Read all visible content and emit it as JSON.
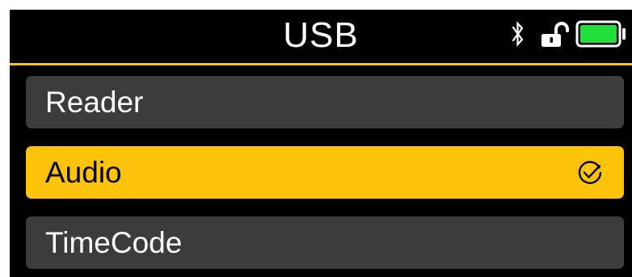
{
  "header": {
    "title": "USB"
  },
  "status": {
    "bluetooth_icon": "bluetooth-icon",
    "lock_icon": "unlocked-padlock-icon",
    "battery_icon": "battery-full-icon",
    "battery_fill_color": "#21E03C"
  },
  "menu": {
    "items": [
      {
        "label": "Reader",
        "selected": false
      },
      {
        "label": "Audio",
        "selected": true,
        "indicator_icon": "check-circle-icon"
      },
      {
        "label": "TimeCode",
        "selected": false
      }
    ]
  },
  "colors": {
    "background": "#000000",
    "accent": "#F7C21A",
    "item_background": "#3C3C3C",
    "selected_background": "#FCC30A",
    "text": "#FFFFFF",
    "selected_text": "#000000"
  }
}
